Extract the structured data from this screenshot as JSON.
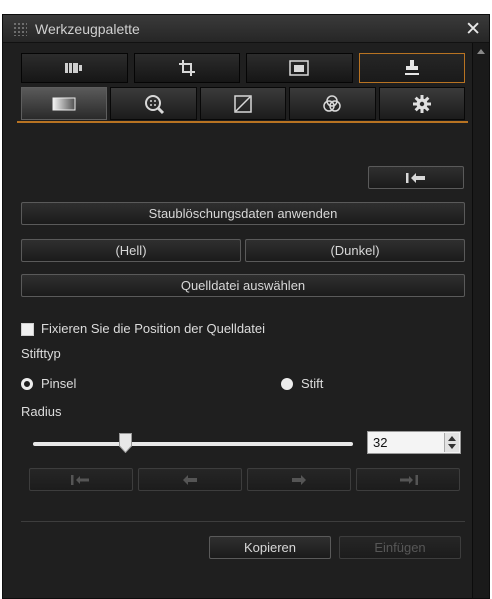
{
  "window": {
    "title": "Werkzeugpalette"
  },
  "tabs_top": [
    {
      "icon": "basic-adjustment-icon"
    },
    {
      "icon": "crop-icon"
    },
    {
      "icon": "image-tone-icon"
    },
    {
      "icon": "stamp-tool-icon",
      "active": true
    }
  ],
  "tabs_sub": [
    {
      "icon": "image-adjust-icon",
      "active": true
    },
    {
      "icon": "noise-reduction-icon"
    },
    {
      "icon": "tone-curve-icon"
    },
    {
      "icon": "color-adjust-icon"
    },
    {
      "icon": "settings-gear-icon"
    }
  ],
  "buttons": {
    "apply_dust_data": "Staublöschungsdaten anwenden",
    "light": "(Hell)",
    "dark": "(Dunkel)",
    "select_source": "Quelldatei auswählen",
    "copy": "Kopieren",
    "paste": "Einfügen"
  },
  "fix_source": {
    "label": "Fixieren Sie die Position der Quelldatei",
    "checked": false
  },
  "pen_type": {
    "label": "Stifttyp",
    "options": [
      {
        "label": "Pinsel",
        "selected": false
      },
      {
        "label": "Stift",
        "selected": true
      }
    ]
  },
  "radius": {
    "label": "Radius",
    "value": "32"
  },
  "colors": {
    "accent": "#b87322",
    "panel_bg": "#1f1f1f"
  }
}
